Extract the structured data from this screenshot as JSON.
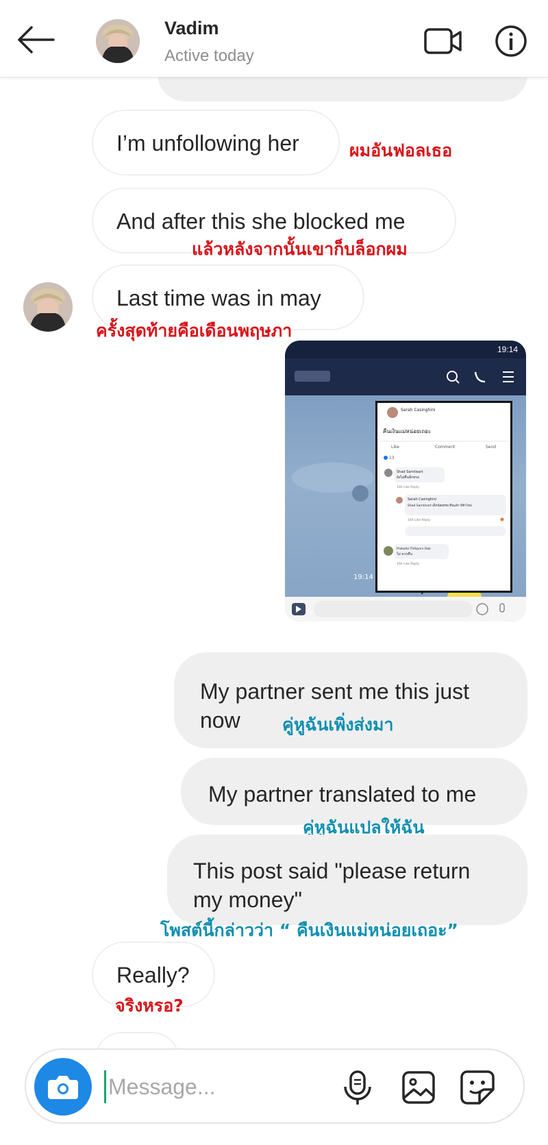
{
  "header": {
    "name": "Vadim",
    "status": "Active today"
  },
  "messages": [
    {
      "text": "I’m unfollowing her",
      "translation": "ผมอันฟอลเธอ"
    },
    {
      "text": "And after this she blocked me",
      "translation": "แล้วหลังจากนั้นเขาก็บล็อกผม"
    },
    {
      "text": "Last time was in may",
      "translation": "ครั้งสุดท้ายคือเดือนพฤษภา"
    },
    {
      "text": "My partner sent me this just now",
      "line1": "My partner sent me this just",
      "line2": "now",
      "translation": "คู่หูฉันเพิ่งส่งมา"
    },
    {
      "text": "My partner translated to me",
      "translation": "คู่หูฉันแปลให้ฉัน"
    },
    {
      "text": "This post said \"please return my money\"",
      "line1": "This post said \"please return",
      "line2": "my money\"",
      "translation": "โพสต์นี้กล่าวว่า “ คืนเงินแม่หน่อยเถอะ”"
    },
    {
      "text": "Really?",
      "translation": "จริงหรอ?"
    }
  ],
  "screenshot": {
    "time": "19:14",
    "post_author": "Sarah Casinghini",
    "post_text": "คืนเงินแม่หน่อยเถอะ",
    "actions": [
      "Like",
      "Comment",
      "Send"
    ],
    "reaction_count": "13",
    "comments": [
      {
        "author": "Shad Sarntisart",
        "text": "ยังไม่คืนอีกหรอ"
      },
      {
        "author": "Sarah Casinghini",
        "text": "Shad Sarntisart เด็กน้อยหรอ คืนแล้ว นี่ข้าไหม่"
      },
      {
        "author": "Pratwitz Thitiporn Dok",
        "text": "ไม่ ควรคืน"
      }
    ],
    "comment_meta": "16h   Like   Reply",
    "msg_time": "19:14"
  },
  "composer": {
    "placeholder": "Message..."
  },
  "colors": {
    "accent": "#1e88e5",
    "thai_red": "#d8141a",
    "thai_teal": "#0f8fb0",
    "bubble_gray": "#efefef"
  }
}
